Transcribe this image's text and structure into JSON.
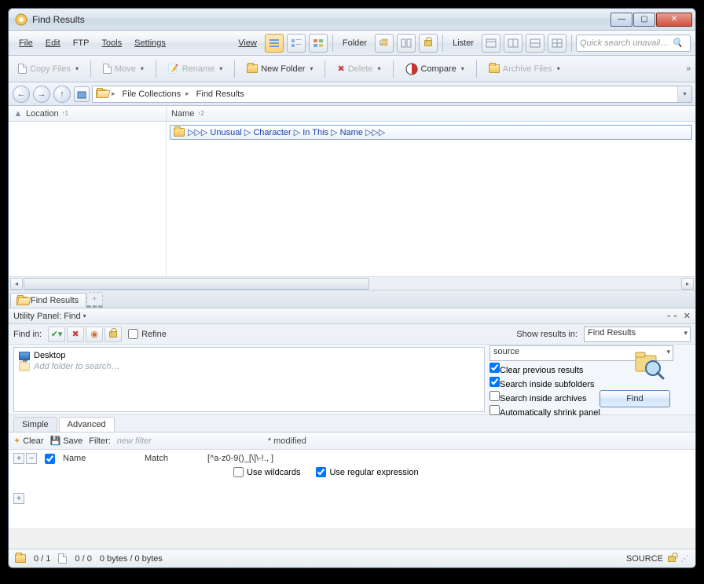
{
  "title": "Find Results",
  "menu": {
    "file": "File",
    "edit": "Edit",
    "ftp": "FTP",
    "tools": "Tools",
    "settings": "Settings",
    "view": "View",
    "folder": "Folder",
    "lister": "Lister"
  },
  "search_placeholder": "Quick search unavail…",
  "toolbar2": {
    "copy": "Copy Files",
    "move": "Move",
    "rename": "Rename",
    "newfolder": "New Folder",
    "delete": "Delete",
    "compare": "Compare",
    "archive": "Archive Files"
  },
  "breadcrumb": {
    "seg1": "File Collections",
    "seg2": "Find Results"
  },
  "columns": {
    "location": "Location",
    "loc_sort": "↑1",
    "name": "Name",
    "name_sort": "↑2"
  },
  "result_name": "▷▷▷ Unusual ▷ Character ▷ In This ▷ Name ▷▷▷",
  "tab_find": "Find Results",
  "utility": {
    "label": "Utility Panel:",
    "name": "Find"
  },
  "findin": "Find in:",
  "refine": "Refine",
  "show_results": "Show results in:",
  "dd_findresults": "Find Results",
  "dd_source": "source",
  "opt_clear": "Clear previous results",
  "opt_subfolders": "Search inside subfolders",
  "opt_archives": "Search inside archives",
  "opt_shrink": "Automatically shrink panel",
  "find_btn": "Find",
  "folder_desktop": "Desktop",
  "folder_hint": "Add folder to search…",
  "ftab_simple": "Simple",
  "ftab_advanced": "Advanced",
  "clear": "Clear",
  "save": "Save",
  "filter_lbl": "Filter:",
  "filter_new": "new filter",
  "modified": "* modified",
  "rule_name": "Name",
  "rule_match": "Match",
  "rule_pattern": "[^a-z0-9()_[\\]\\-!., ]",
  "use_wildcards": "Use wildcards",
  "use_regex": "Use regular expression",
  "status": {
    "count": "0 / 1",
    "sel": "0 / 0",
    "bytes": "0 bytes / 0 bytes",
    "source": "SOURCE"
  }
}
